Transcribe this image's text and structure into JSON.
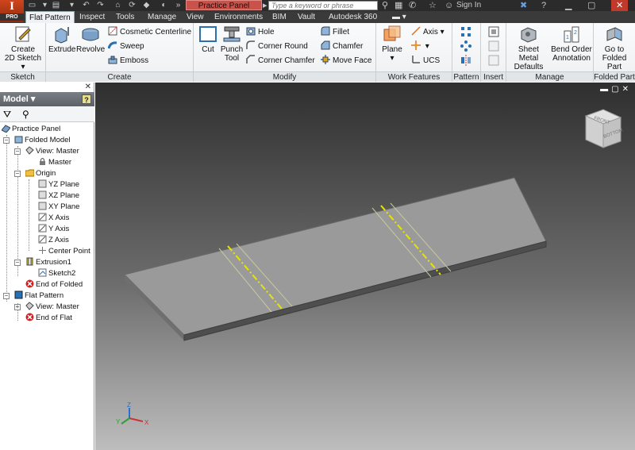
{
  "titlebar": {
    "logo_letter": "I",
    "logo_edition": "PRO",
    "document_title": "Practice Panel",
    "search_placeholder": "Type a keyword or phrase",
    "sign_in": "Sign In"
  },
  "ribbon_tabs": [
    "Flat Pattern",
    "Inspect",
    "Tools",
    "Manage",
    "View",
    "Environments",
    "BIM",
    "Vault",
    "Autodesk 360"
  ],
  "ribbon": {
    "sketch": {
      "label": "Sketch",
      "create_2d_sketch": "Create",
      "create_2d_sketch_2": "2D Sketch"
    },
    "create": {
      "label": "Create",
      "extrude": "Extrude",
      "revolve": "Revolve",
      "cosmetic_centerline": "Cosmetic Centerline",
      "sweep": "Sweep",
      "emboss": "Emboss"
    },
    "modify": {
      "label": "Modify",
      "cut": "Cut",
      "punch_tool": "Punch",
      "punch_tool_2": "Tool",
      "hole": "Hole",
      "corner_round": "Corner Round",
      "corner_chamfer": "Corner Chamfer",
      "fillet": "Fillet",
      "chamfer": "Chamfer",
      "move_face": "Move Face"
    },
    "work_features": {
      "label": "Work Features",
      "plane": "Plane",
      "axis": "Axis",
      "ucs": "UCS"
    },
    "pattern": {
      "label": "Pattern"
    },
    "insert": {
      "label": "Insert"
    },
    "manage": {
      "label": "Manage",
      "sheet_metal_defaults": "Sheet Metal",
      "sheet_metal_defaults_2": "Defaults",
      "bend_order": "Bend Order",
      "bend_order_2": "Annotation"
    },
    "folded_part": {
      "label": "Folded Part",
      "go_to": "Go to",
      "go_to_2": "Folded Part"
    }
  },
  "browser": {
    "title": "Model",
    "help": "?",
    "tree": {
      "root": "Practice Panel",
      "folded_model": "Folded Model",
      "view_master": "View: Master",
      "master": "Master",
      "origin": "Origin",
      "yz_plane": "YZ Plane",
      "xz_plane": "XZ Plane",
      "xy_plane": "XY Plane",
      "x_axis": "X Axis",
      "y_axis": "Y Axis",
      "z_axis": "Z Axis",
      "center_point": "Center Point",
      "extrusion1": "Extrusion1",
      "sketch2": "Sketch2",
      "end_of_folded": "End of Folded",
      "flat_pattern": "Flat Pattern",
      "view_master_2": "View: Master",
      "end_of_flat": "End of Flat"
    }
  },
  "viewcube": {
    "face_top": "FRONT",
    "face_front": "BOTTOM"
  },
  "triad": {
    "x": "X",
    "y": "Y",
    "z": "Z"
  },
  "colors": {
    "sketch_line": "#e6e600",
    "part_top": "#9a9a9a",
    "part_edge": "#5a5a5a"
  }
}
